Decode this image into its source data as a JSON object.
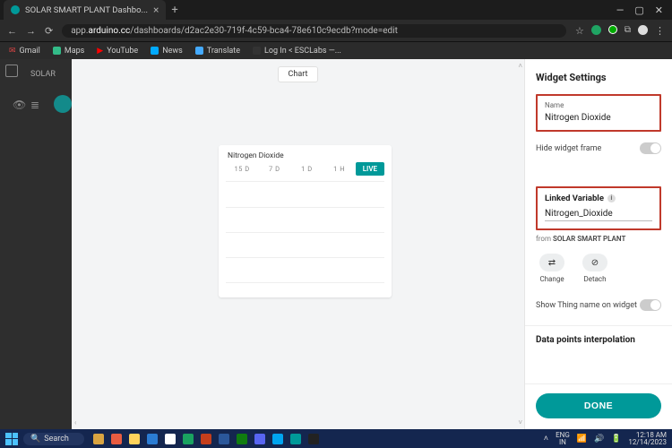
{
  "browser": {
    "tab_title": "SOLAR SMART PLANT Dashbo...",
    "url_prefix": "app.",
    "url_domain": "arduino.cc",
    "url_path": "/dashboards/d2ac2e30-719f-4c59-bca4-78e610c9ecdb?mode=edit",
    "bookmarks": {
      "gmail": "Gmail",
      "maps": "Maps",
      "youtube": "YouTube",
      "news": "News",
      "translate": "Translate",
      "esclabs": "Log In < ESCLabs —..."
    }
  },
  "app": {
    "left": {
      "project_prefix": "SOLAR"
    },
    "canvas": {
      "chart_button": "Chart"
    },
    "widget": {
      "title": "Nitrogen Dioxide",
      "ranges": {
        "d15": "15 D",
        "d7": "7 D",
        "d1": "1 D",
        "h1": "1 H",
        "live": "LIVE"
      }
    },
    "settings": {
      "title": "Widget Settings",
      "name_label": "Name",
      "name_value": "Nitrogen Dioxide",
      "hide_frame": "Hide widget frame",
      "linked_var_label": "Linked Variable",
      "linked_var_value": "Nitrogen_Dioxide",
      "from_prefix": "from ",
      "from_thing": "SOLAR SMART PLANT",
      "change": "Change",
      "detach": "Detach",
      "show_thing": "Show Thing name on widget",
      "interpolation": "Data points interpolation",
      "done": "DONE"
    }
  },
  "taskbar": {
    "search": "Search",
    "lang": "ENG",
    "region": "IN",
    "time": "12:18 AM",
    "date": "12/14/2023"
  }
}
